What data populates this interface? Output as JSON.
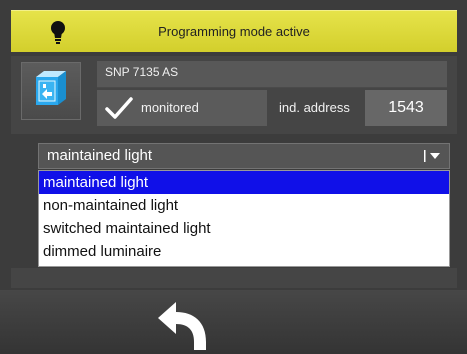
{
  "status_bar": {
    "text": "Programming mode active",
    "icon": "lightbulb-icon",
    "color": "#dedb3c"
  },
  "device": {
    "icon": "emergency-exit-luminaire-icon",
    "name": "SNP 7135 AS",
    "monitored_checked": true,
    "monitored_label": "monitored",
    "address_label": "ind. address",
    "address_value": "1543"
  },
  "mode_select": {
    "selected_value": "maintained light",
    "options": [
      {
        "label": "maintained light",
        "selected": true
      },
      {
        "label": "non-maintained light",
        "selected": false
      },
      {
        "label": "switched maintained light",
        "selected": false
      },
      {
        "label": "dimmed luminaire",
        "selected": false
      }
    ],
    "highlight_color": "#1010e8"
  },
  "footer": {
    "back_icon": "back-arrow-icon"
  }
}
